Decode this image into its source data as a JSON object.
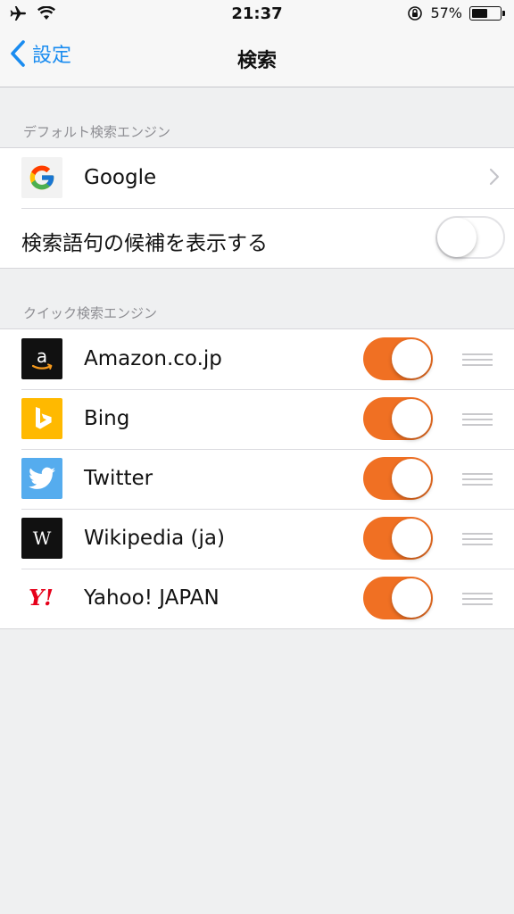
{
  "status_bar": {
    "time": "21:37",
    "battery_text": "57%",
    "battery_level": 0.57,
    "icons": [
      "airplane-icon",
      "wifi-icon",
      "orientation-lock-icon",
      "battery-icon"
    ]
  },
  "nav": {
    "back_label": "設定",
    "title": "検索"
  },
  "default_section": {
    "header": "デフォルト検索エンジン",
    "engine": {
      "label": "Google",
      "icon": "google-icon"
    },
    "suggest": {
      "label": "検索語句の候補を表示する",
      "enabled": false
    }
  },
  "quick_section": {
    "header": "クイック検索エンジン",
    "engines": [
      {
        "label": "Amazon.co.jp",
        "icon": "amazon-icon",
        "enabled": true
      },
      {
        "label": "Bing",
        "icon": "bing-icon",
        "enabled": true
      },
      {
        "label": "Twitter",
        "icon": "twitter-icon",
        "enabled": true
      },
      {
        "label": "Wikipedia (ja)",
        "icon": "wikipedia-icon",
        "enabled": true
      },
      {
        "label": "Yahoo! JAPAN",
        "icon": "yahoo-japan-icon",
        "enabled": true
      }
    ]
  },
  "colors": {
    "accent_blue": "#1a8cf0",
    "toggle_on": "#f07023",
    "background": "#eff0f1"
  }
}
